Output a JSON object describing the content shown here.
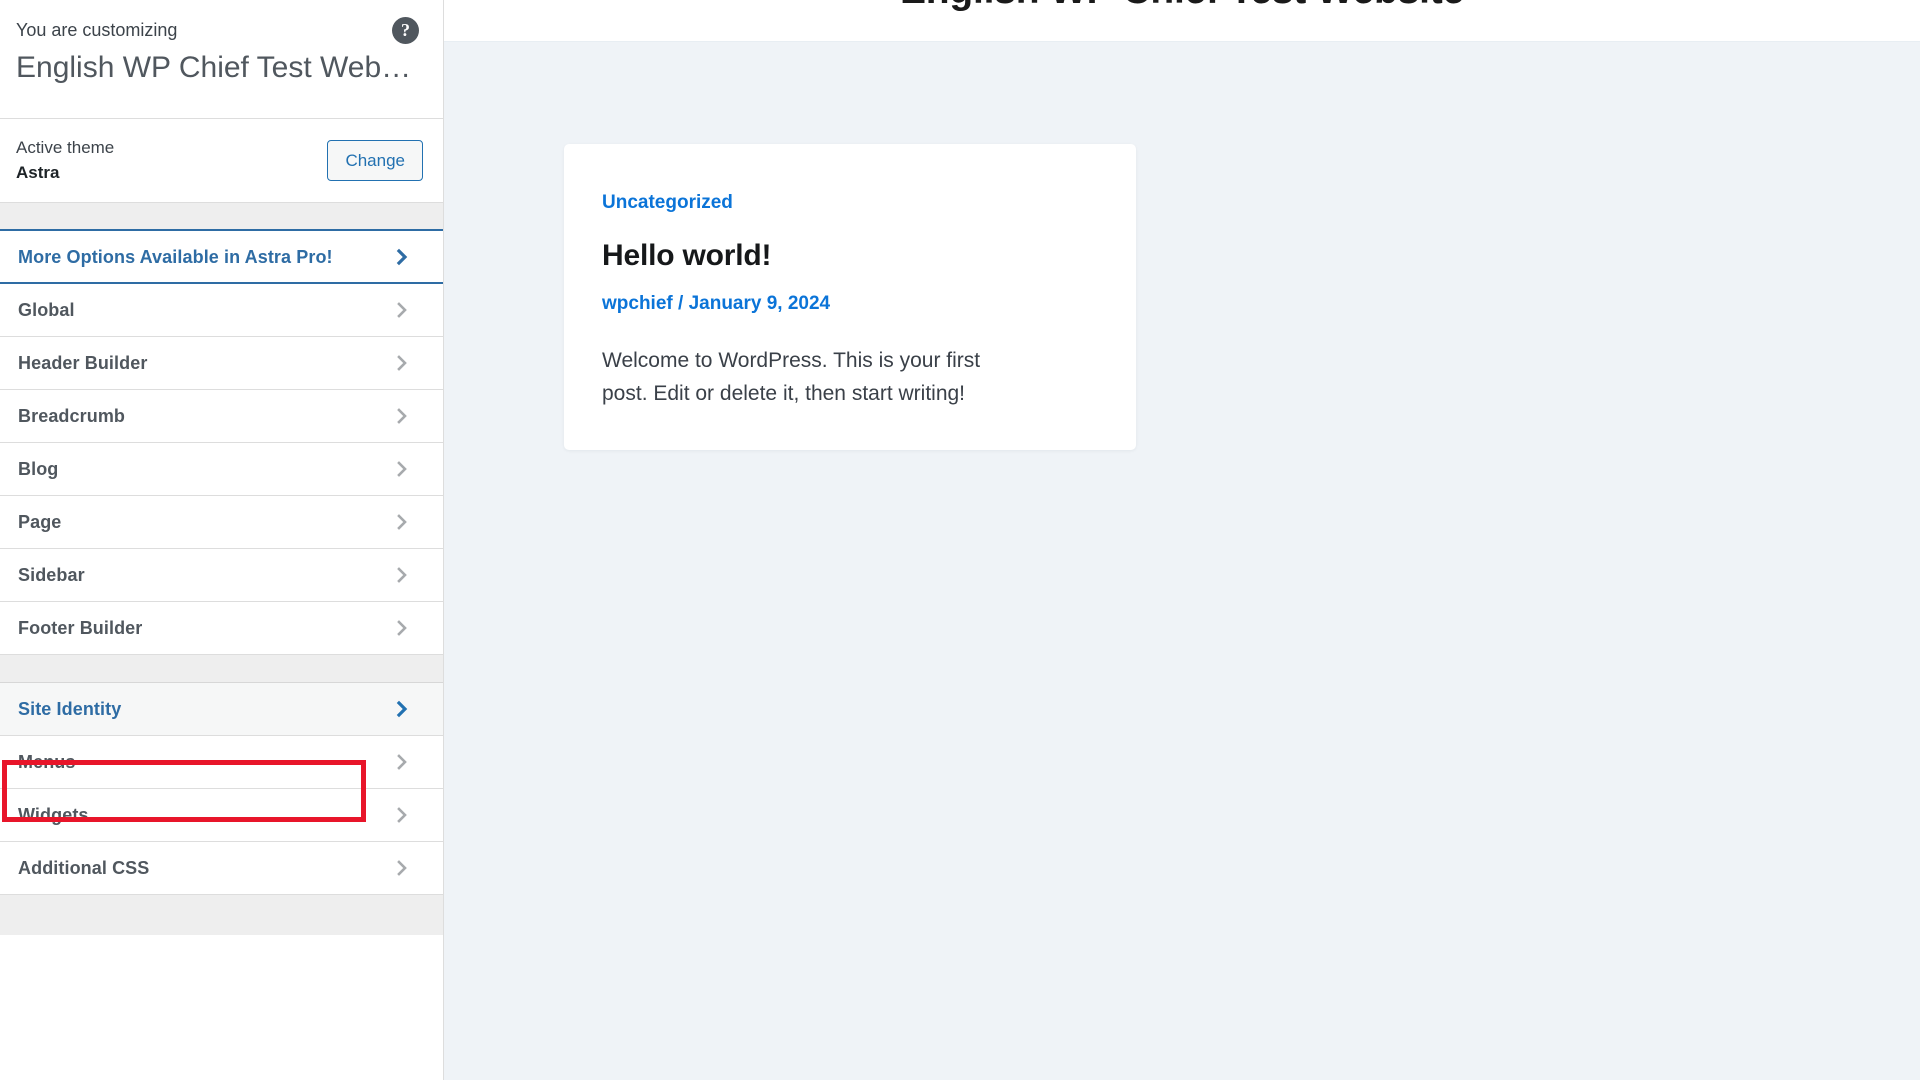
{
  "customizer": {
    "header": {
      "eyebrow": "You are customizing",
      "site_name": "English WP Chief Test Website",
      "help_icon": "help-circle-icon",
      "help_glyph": "?"
    },
    "theme": {
      "label": "Active theme",
      "name": "Astra",
      "change_label": "Change"
    },
    "menu_items": [
      {
        "label": "More Options Available in Astra Pro!",
        "icon": "chevron-right-icon",
        "state": "promo"
      },
      {
        "label": "Global",
        "icon": "chevron-right-icon",
        "state": "default"
      },
      {
        "label": "Header Builder",
        "icon": "chevron-right-icon",
        "state": "default"
      },
      {
        "label": "Breadcrumb",
        "icon": "chevron-right-icon",
        "state": "default"
      },
      {
        "label": "Blog",
        "icon": "chevron-right-icon",
        "state": "default"
      },
      {
        "label": "Page",
        "icon": "chevron-right-icon",
        "state": "default"
      },
      {
        "label": "Sidebar",
        "icon": "chevron-right-icon",
        "state": "default"
      },
      {
        "label": "Footer Builder",
        "icon": "chevron-right-icon",
        "state": "default"
      },
      {
        "label": "Site Identity",
        "icon": "chevron-right-icon",
        "state": "active"
      },
      {
        "label": "Menus",
        "icon": "chevron-right-icon",
        "state": "default"
      },
      {
        "label": "Widgets",
        "icon": "chevron-right-icon",
        "state": "default"
      },
      {
        "label": "Additional CSS",
        "icon": "chevron-right-icon",
        "state": "default"
      }
    ]
  },
  "preview": {
    "site_title": "English WP Chief Test Website",
    "post": {
      "category": "Uncategorized",
      "title": "Hello world!",
      "author": "wpchief",
      "meta_separator": " / ",
      "date": "January 9, 2024",
      "excerpt": "Welcome to WordPress. This is your first post. Edit or delete it, then start writing!"
    }
  },
  "colors": {
    "accent_blue": "#2271b1",
    "promo_blue": "#2e6ca4",
    "link_blue": "#0b74d8",
    "highlight_red": "#e8152a",
    "preview_bg": "#eff3f7",
    "band_gray": "#eeeeee"
  }
}
